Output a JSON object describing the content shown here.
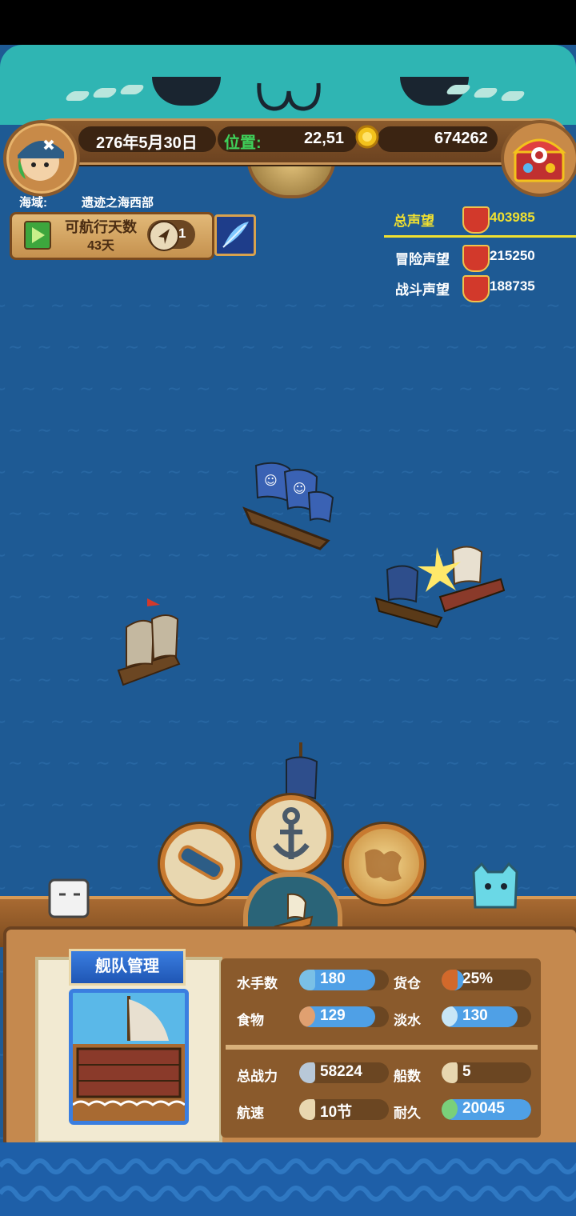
{
  "status_bar": {
    "date": "276年5月30日",
    "position_label": "位置:",
    "position_value": "22,51",
    "gold": "674262"
  },
  "sea": {
    "label": "海域:",
    "name": "遗迹之海西部"
  },
  "voyage": {
    "title": "可航行天数",
    "days": "43天",
    "compass_count": "1"
  },
  "reputation": {
    "total_label": "总声望",
    "total_value": "403985",
    "adventure_label": "冒险声望",
    "adventure_value": "215250",
    "battle_label": "战斗声望",
    "battle_value": "188735"
  },
  "fleet": {
    "title": "舰队管理",
    "sailors_label": "水手数",
    "sailors_value": "180",
    "sailors_level": 0.85,
    "cargo_label": "货仓",
    "cargo_value": "25%",
    "cargo_level": 0.25,
    "food_label": "食物",
    "food_value": "129",
    "food_level": 0.85,
    "water_label": "淡水",
    "water_value": "130",
    "water_level": 0.85,
    "power_label": "总战力",
    "power_value": "58224",
    "ships_label": "船数",
    "ships_value": "5",
    "speed_label": "航速",
    "speed_value": "10节",
    "durability_label": "耐久",
    "durability_value": "20045",
    "durability_level": 1.0
  },
  "colors": {
    "ocean": "#1e5a94",
    "banner_teal": "#2fb5b3",
    "wood": "#8a5a2c",
    "bar_blue": "#4fa0e6",
    "total_rep_yellow": "#f0e030"
  },
  "icons": [
    "avatar-pirate-icon",
    "coin-icon",
    "treasure-chest-icon",
    "globe-icon",
    "play-icon",
    "compass-icon",
    "feather-icon",
    "shield-icon",
    "telescope-icon",
    "anchor-icon",
    "map-icon",
    "ship-icon"
  ]
}
